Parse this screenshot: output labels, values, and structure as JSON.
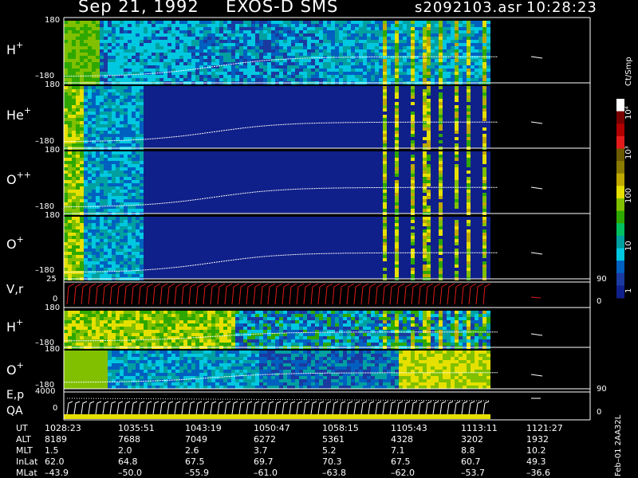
{
  "header": {
    "date": "Sep 21, 1992",
    "instrument": "EXOS-D SMS",
    "filename": "s2092103.asr",
    "time": "10:28:23"
  },
  "panels": {
    "h_plus": {
      "label": "H",
      "sup": "+",
      "tick_top": "180",
      "tick_bottom": "–180"
    },
    "he_plus": {
      "label": "He",
      "sup": "+",
      "tick_top": "180",
      "tick_bottom": "–180"
    },
    "o_plusplus": {
      "label": "O",
      "sup": "++",
      "tick_top": "180",
      "tick_bottom": "–180"
    },
    "o_plus": {
      "label": "O",
      "sup": "+",
      "tick_top": "180",
      "tick_bottom": "–180"
    },
    "vr": {
      "label": "V,r",
      "tick_top": "25",
      "tick_bottom": "0",
      "right_top": "90",
      "right_bottom": "0"
    },
    "h_plus_2": {
      "label": "H",
      "sup": "+",
      "tick_top": "180",
      "tick_bottom": "–180"
    },
    "o_plus_2": {
      "label": "O",
      "sup": "+",
      "tick_top": "180",
      "tick_bottom": "–180"
    },
    "ep": {
      "label": "E,p",
      "tick_top": "4000",
      "tick_bottom": "0",
      "right_top": "90",
      "right_bottom": "0"
    },
    "qa": {
      "label": "QA"
    }
  },
  "colorbar": {
    "unit": "Ct/Smp",
    "labels": [
      "10⁴",
      "10³",
      "100",
      "10",
      "1"
    ],
    "colors": [
      "#ffffff",
      "#7a0000",
      "#b00000",
      "#e41b1b",
      "#6b5a00",
      "#8a7a00",
      "#c0a800",
      "#e6e000",
      "#80c000",
      "#2ea800",
      "#00c060",
      "#00a0a0",
      "#00c8e0",
      "#0060c0",
      "#1a3aa0",
      "#10208a"
    ]
  },
  "footer": {
    "rows": [
      {
        "name": "UT",
        "values": [
          "1028:23",
          "1035:51",
          "1043:19",
          "1050:47",
          "1058:15",
          "1105:43",
          "1113:11",
          "1121:27"
        ]
      },
      {
        "name": "ALT",
        "values": [
          "8189",
          "7688",
          "7049",
          "6272",
          "5361",
          "4328",
          "3202",
          "1932"
        ]
      },
      {
        "name": "MLT",
        "values": [
          "1.5",
          "2.0",
          "2.6",
          "3.7",
          "5.2",
          "7.1",
          "8.8",
          "10.2"
        ]
      },
      {
        "name": "InLat",
        "values": [
          "62.0",
          "64.8",
          "67.5",
          "69.7",
          "70.3",
          "67.5",
          "60.7",
          "49.3"
        ]
      },
      {
        "name": "MLat",
        "values": [
          "–43.9",
          "–50.0",
          "–55.9",
          "–61.0",
          "–63.8",
          "–62.0",
          "–53.7",
          "–36.6"
        ]
      }
    ],
    "stamp": "Feb–01  2AA32L"
  },
  "chart_data": {
    "type": "heatmap",
    "title": "Sep 21, 1992   EXOS-D SMS",
    "x_ticks_ut": [
      "1028:23",
      "1035:51",
      "1043:19",
      "1050:47",
      "1058:15",
      "1105:43",
      "1113:11",
      "1121:27"
    ],
    "series": [
      {
        "name": "H+",
        "ylim": [
          -180,
          180
        ]
      },
      {
        "name": "He+",
        "ylim": [
          -180,
          180
        ]
      },
      {
        "name": "O++",
        "ylim": [
          -180,
          180
        ]
      },
      {
        "name": "O+",
        "ylim": [
          -180,
          180
        ]
      },
      {
        "name": "V,r",
        "ylim": [
          0,
          25
        ],
        "right_ylim": [
          0,
          90
        ]
      },
      {
        "name": "H+",
        "ylim": [
          -180,
          180
        ]
      },
      {
        "name": "O+",
        "ylim": [
          -180,
          180
        ]
      },
      {
        "name": "E,p",
        "ylim": [
          0,
          4000
        ],
        "right_ylim": [
          0,
          90
        ]
      },
      {
        "name": "QA"
      }
    ],
    "colorbar_ticks": [
      "1",
      "10",
      "100",
      "10³",
      "10⁴"
    ]
  }
}
